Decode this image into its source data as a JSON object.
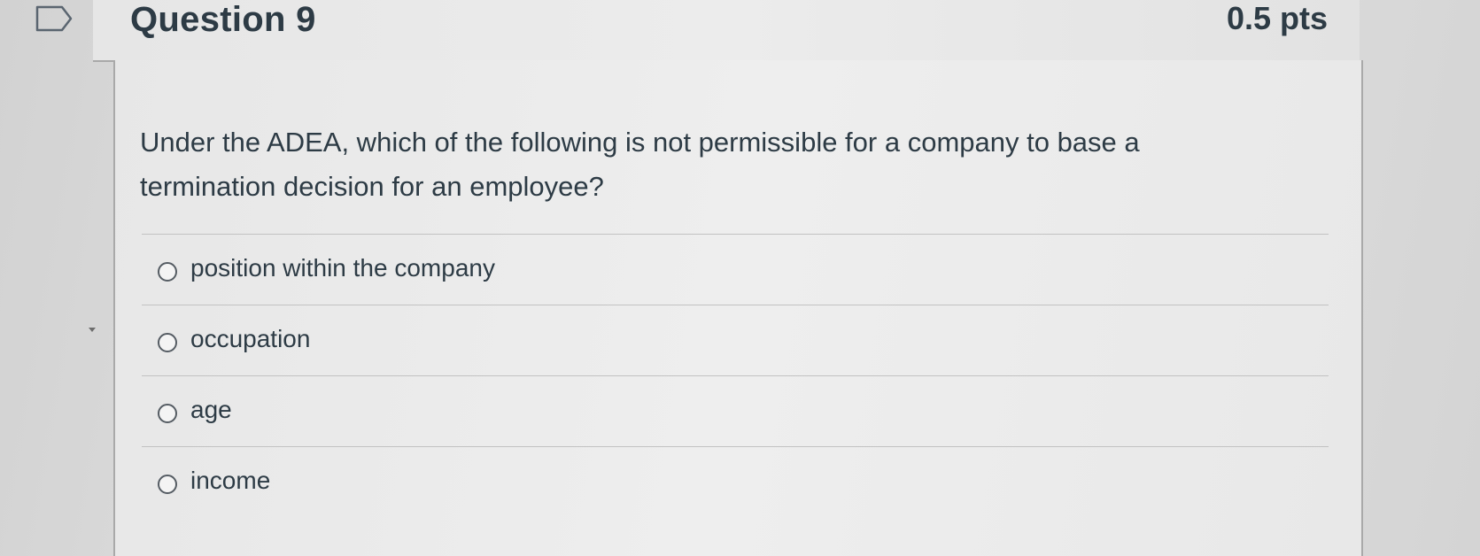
{
  "question": {
    "title": "Question 9",
    "points": "0.5 pts",
    "text": "Under the ADEA, which of the following is not permissible for a company to base a termination decision for an employee?"
  },
  "answers": [
    {
      "label": "position within the company",
      "selected": false
    },
    {
      "label": "occupation",
      "selected": false
    },
    {
      "label": "age",
      "selected": false
    },
    {
      "label": "income",
      "selected": false
    }
  ],
  "icons": {
    "bookmark": "bookmark-flag-icon"
  }
}
